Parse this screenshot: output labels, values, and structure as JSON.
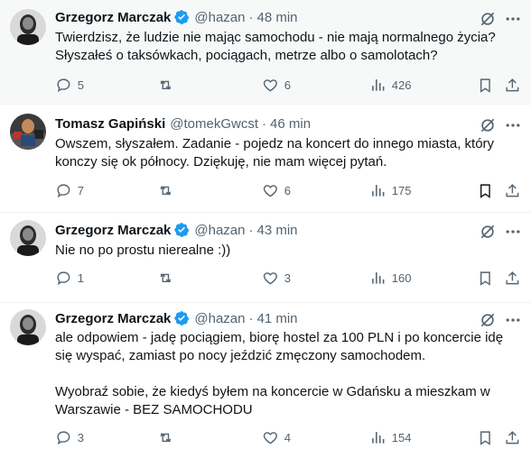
{
  "colors": {
    "text": "#0f1419",
    "muted": "#536471",
    "verified": "#1d9bf0",
    "highlight_bg": "#f7f9f9",
    "border": "#eff3f4"
  },
  "tweets": [
    {
      "author": "Grzegorz Marczak",
      "handle": "@hazan",
      "separator": "·",
      "time": "48 min",
      "verified": true,
      "text": "Twierdzisz, że ludzie nie mając samochodu - nie mają normalnego życia?\nSłyszałeś o taksówkach, pociągach, metrze albo o samolotach?",
      "replies": "5",
      "retweets": "",
      "likes": "6",
      "views": "426"
    },
    {
      "author": "Tomasz Gapiński",
      "handle": "@tomekGwcst",
      "separator": "·",
      "time": "46 min",
      "verified": false,
      "text": "Owszem, słyszałem. Zadanie - pojedz na koncert do innego miasta, który\nkonczy się ok północy. Dziękuję, nie mam więcej pytań.",
      "replies": "7",
      "retweets": "",
      "likes": "6",
      "views": "175"
    },
    {
      "author": "Grzegorz Marczak",
      "handle": "@hazan",
      "separator": "·",
      "time": "43 min",
      "verified": true,
      "text": "Nie no po prostu nierealne :))",
      "replies": "1",
      "retweets": "",
      "likes": "3",
      "views": "160"
    },
    {
      "author": "Grzegorz Marczak",
      "handle": "@hazan",
      "separator": "·",
      "time": "41 min",
      "verified": true,
      "text": "ale odpowiem - jadę pociągiem, biorę hostel za 100 PLN i po koncercie idę\nsię wyspać, zamiast po nocy jeździć zmęczony samochodem.\n\nWyobraź sobie, że kiedyś byłem na koncercie w Gdańsku a mieszkam w\nWarszawie - BEZ SAMOCHODU",
      "replies": "3",
      "retweets": "",
      "likes": "4",
      "views": "154"
    }
  ]
}
